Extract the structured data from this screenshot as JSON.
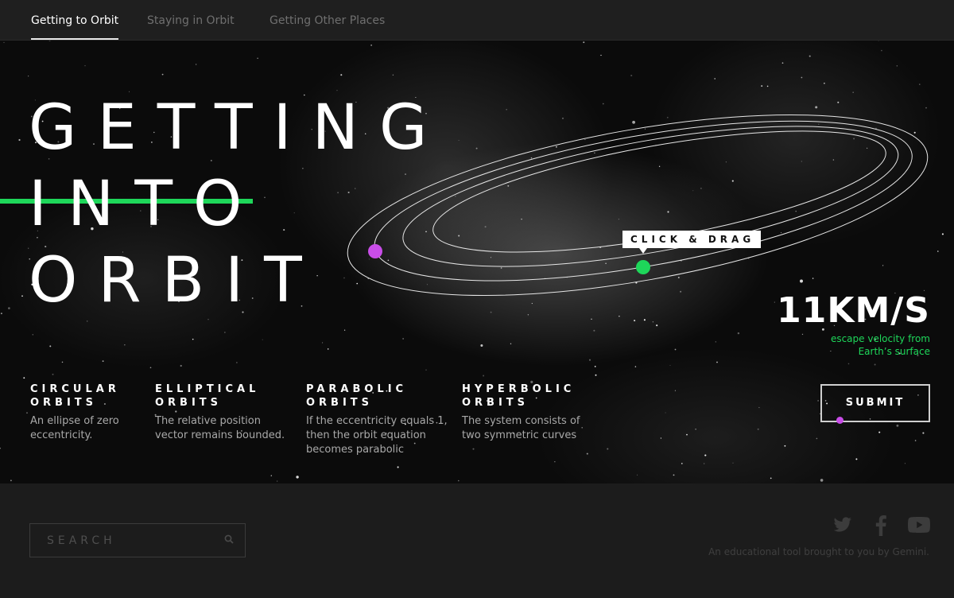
{
  "nav": {
    "tabs": [
      {
        "label": "Getting to Orbit",
        "active": true
      },
      {
        "label": "Staying in Orbit",
        "active": false
      },
      {
        "label": "Getting Other Places",
        "active": false
      }
    ]
  },
  "hero": {
    "title_lines": [
      "GETTING",
      "INTO",
      "ORBIT"
    ],
    "drag_label": "CLICK & DRAG",
    "velocity": {
      "value": "11KM/S",
      "caption": "escape velocity from Earth’s surface"
    },
    "orbit_types": [
      {
        "title": "CIRCULAR\nORBITS",
        "description": "An ellipse of zero eccentricity."
      },
      {
        "title": "ELLIPTICAL\nORBITS",
        "description": "The relative position vector remains bounded."
      },
      {
        "title": "PARABOLIC\nORBITS",
        "description": "If the eccentricity equals 1, then the orbit equation becomes parabolic"
      },
      {
        "title": "HYPERBOLIC\nORBITS",
        "description": " The system consists of two symmetric curves"
      }
    ],
    "submit_label": "SUBMIT"
  },
  "footer": {
    "search_placeholder": "SEARCH",
    "social": [
      "twitter-icon",
      "facebook-icon",
      "youtube-icon"
    ],
    "note": "An educational tool brought to you by Gemini."
  },
  "colors": {
    "accent_green": "#1ed75a",
    "accent_purple": "#c94de8",
    "background": "#1c1c1c"
  }
}
